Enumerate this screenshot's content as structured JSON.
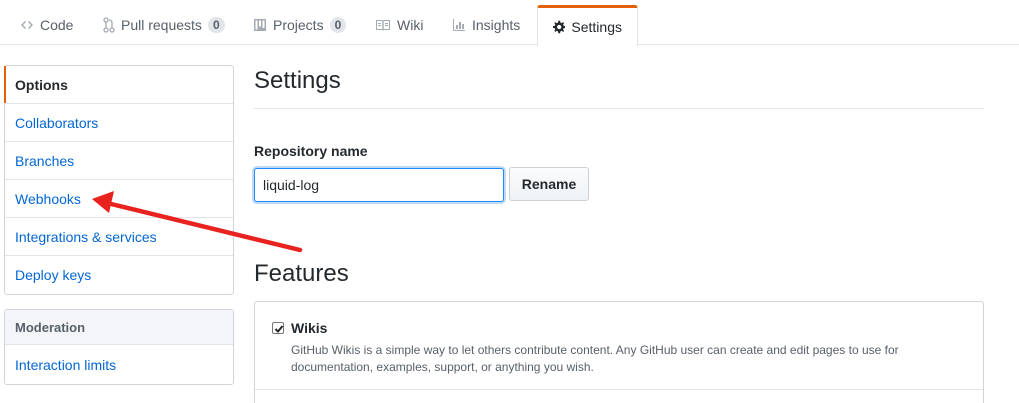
{
  "tabs": [
    {
      "label": "Code",
      "icon": "code-icon"
    },
    {
      "label": "Pull requests",
      "icon": "pull-request-icon",
      "count": "0"
    },
    {
      "label": "Projects",
      "icon": "project-icon",
      "count": "0"
    },
    {
      "label": "Wiki",
      "icon": "book-icon"
    },
    {
      "label": "Insights",
      "icon": "graph-icon"
    },
    {
      "label": "Settings",
      "icon": "gear-icon",
      "selected": true
    }
  ],
  "sidebar": {
    "items": [
      {
        "label": "Options",
        "selected": true
      },
      {
        "label": "Collaborators"
      },
      {
        "label": "Branches"
      },
      {
        "label": "Webhooks"
      },
      {
        "label": "Integrations & services"
      },
      {
        "label": "Deploy keys"
      }
    ],
    "moderation": {
      "heading": "Moderation",
      "items": [
        {
          "label": "Interaction limits"
        }
      ]
    }
  },
  "main": {
    "title": "Settings",
    "repo_name": {
      "label": "Repository name",
      "value": "liquid-log",
      "button": "Rename"
    },
    "features": {
      "title": "Features",
      "items": [
        {
          "name": "Wikis",
          "checked": true,
          "description": "GitHub Wikis is a simple way to let others contribute content. Any GitHub user can create and edit pages to use for documentation, examples, support, or anything you wish."
        }
      ]
    }
  },
  "colors": {
    "link": "#0366d6",
    "selected_accent": "#e36209",
    "annotation_arrow": "#e8231f"
  }
}
